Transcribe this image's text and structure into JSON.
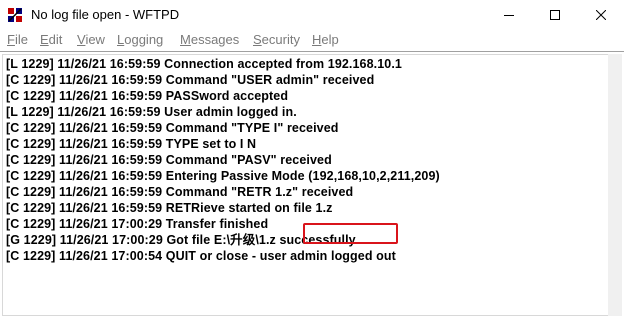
{
  "window": {
    "title": "No log file open - WFTPD"
  },
  "menu": {
    "items": [
      "File",
      "Edit",
      "View",
      "Logging",
      "Messages",
      "Security",
      "Help"
    ]
  },
  "log": {
    "lines": [
      "[L 1229] 11/26/21 16:59:59 Connection accepted from 192.168.10.1",
      "[C 1229] 11/26/21 16:59:59 Command \"USER admin\" received",
      "[C 1229] 11/26/21 16:59:59 PASSword accepted",
      "[L 1229] 11/26/21 16:59:59 User admin logged in.",
      "[C 1229] 11/26/21 16:59:59 Command \"TYPE I\" received",
      "[C 1229] 11/26/21 16:59:59 TYPE set to I N",
      "[C 1229] 11/26/21 16:59:59 Command \"PASV\" received",
      "[C 1229] 11/26/21 16:59:59 Entering Passive Mode (192,168,10,2,211,209)",
      "[C 1229] 11/26/21 16:59:59 Command \"RETR 1.z\" received",
      "[C 1229] 11/26/21 16:59:59 RETRieve started on file 1.z",
      "[C 1229] 11/26/21 17:00:29 Transfer finished",
      "[G 1229] 11/26/21 17:00:29 Got file E:\\升级\\1.z successfully",
      "[C 1229] 11/26/21 17:00:54 QUIT or close - user admin logged out"
    ]
  },
  "colors": {
    "highlight": "#d9141b",
    "menu_text": "#7a7a7a"
  }
}
